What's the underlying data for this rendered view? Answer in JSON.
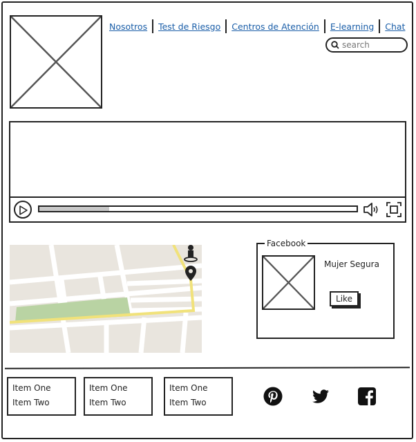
{
  "nav": {
    "links": [
      "Nosotros",
      "Test de Riesgo",
      "Centros de Atención",
      "E-learning",
      "Chat"
    ]
  },
  "search": {
    "placeholder": "search"
  },
  "video": {
    "progress": 0.22
  },
  "facebook": {
    "title": "Facebook",
    "page_name": "Mujer Segura",
    "like_label": "Like"
  },
  "footer": {
    "lists": [
      [
        "Item One",
        "Item Two"
      ],
      [
        "Item One",
        "Item Two"
      ],
      [
        "Item One",
        "Item Two"
      ]
    ],
    "social_icons": [
      "pinterest-icon",
      "twitter-icon",
      "facebook-icon"
    ]
  },
  "colors": {
    "link": "#1a5ea8",
    "map_road_main": "#f1e27a",
    "map_park": "#b9d3a3"
  }
}
